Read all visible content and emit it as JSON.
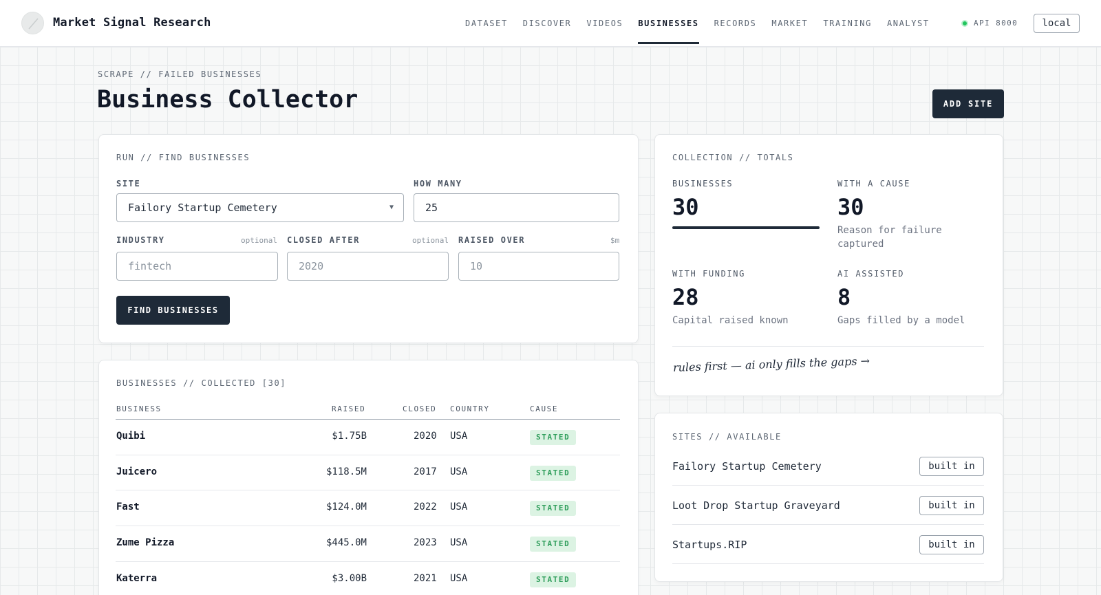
{
  "header": {
    "brand": "Market Signal Research",
    "nav": [
      "DATASET",
      "DISCOVER",
      "VIDEOS",
      "BUSINESSES",
      "RECORDS",
      "MARKET",
      "TRAINING",
      "ANALYST"
    ],
    "active_nav": "BUSINESSES",
    "api_status": "API 8000",
    "api_status_color": "#22c55e",
    "env_label": "local"
  },
  "page": {
    "eyebrow": "SCRAPE // FAILED BUSINESSES",
    "title": "Business Collector",
    "add_site_label": "ADD SITE"
  },
  "run": {
    "label": "RUN // FIND BUSINESSES",
    "site_label": "SITE",
    "site_value": "Failory Startup Cemetery",
    "how_many_label": "HOW MANY",
    "how_many_value": "25",
    "industry_label": "INDUSTRY",
    "industry_hint": "optional",
    "industry_placeholder": "fintech",
    "closed_after_label": "CLOSED AFTER",
    "closed_after_hint": "optional",
    "closed_after_placeholder": "2020",
    "raised_over_label": "RAISED OVER",
    "raised_over_hint": "$m",
    "raised_over_placeholder": "10",
    "find_button": "FIND BUSINESSES"
  },
  "totals": {
    "label": "COLLECTION // TOTALS",
    "businesses_label": "BUSINESSES",
    "businesses_value": "30",
    "businesses_fill": 1.0,
    "cause_label": "WITH A CAUSE",
    "cause_value": "30",
    "cause_desc": "Reason for failure captured",
    "funding_label": "WITH FUNDING",
    "funding_value": "28",
    "funding_desc": "Capital raised known",
    "ai_label": "AI ASSISTED",
    "ai_value": "8",
    "ai_desc": "Gaps filled by a model",
    "note": "rules first — ai only fills the gaps →"
  },
  "collected": {
    "label": "BUSINESSES // COLLECTED [30]",
    "columns": [
      "BUSINESS",
      "RAISED",
      "CLOSED",
      "COUNTRY",
      "CAUSE"
    ],
    "rows": [
      {
        "name": "Quibi",
        "raised": "$1.75B",
        "closed": "2020",
        "country": "USA",
        "cause": "STATED"
      },
      {
        "name": "Juicero",
        "raised": "$118.5M",
        "closed": "2017",
        "country": "USA",
        "cause": "STATED"
      },
      {
        "name": "Fast",
        "raised": "$124.0M",
        "closed": "2022",
        "country": "USA",
        "cause": "STATED"
      },
      {
        "name": "Zume Pizza",
        "raised": "$445.0M",
        "closed": "2023",
        "country": "USA",
        "cause": "STATED"
      },
      {
        "name": "Katerra",
        "raised": "$3.00B",
        "closed": "2021",
        "country": "USA",
        "cause": "STATED"
      }
    ]
  },
  "sites": {
    "label": "SITES // AVAILABLE",
    "items": [
      {
        "name": "Failory Startup Cemetery",
        "tag": "built in"
      },
      {
        "name": "Loot Drop Startup Graveyard",
        "tag": "built in"
      },
      {
        "name": "Startups.RIP",
        "tag": "built in"
      }
    ]
  }
}
